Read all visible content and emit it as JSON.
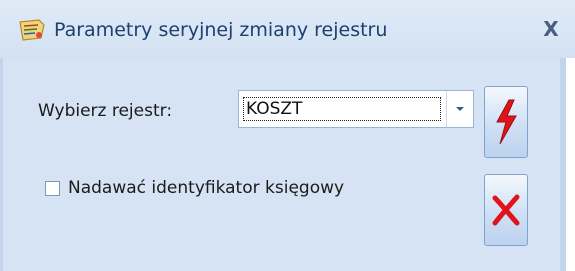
{
  "window": {
    "title": "Parametry seryjnej zmiany rejestru",
    "close_glyph": "X",
    "icon": "app-icon"
  },
  "form": {
    "register_label": "Wybierz rejestr:",
    "register_value": "KOSZT",
    "checkbox_label": "Nadawać identyfikator księgowy",
    "checkbox_checked": false
  },
  "buttons": {
    "run_icon": "lightning-icon",
    "cancel_icon": "red-x-icon"
  },
  "colors": {
    "title_text": "#1f3f6e",
    "panel_bg": "#d5e3f4",
    "accent_red": "#e0131a"
  }
}
